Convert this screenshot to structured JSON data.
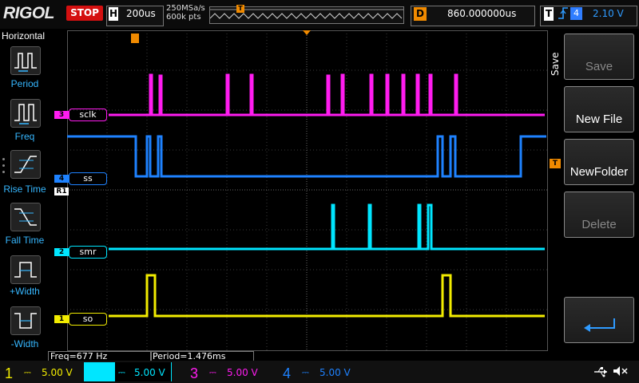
{
  "brand": "RIGOL",
  "run_state": "STOP",
  "horizontal": {
    "letter": "H",
    "timebase": "200us",
    "sample_rate": "250MSa/s",
    "memory_depth": "600k pts"
  },
  "trigger_position_marker": "T",
  "delay": {
    "letter": "D",
    "value": "860.000000us"
  },
  "trigger": {
    "letter": "T",
    "edge_icon": "rising-edge-icon",
    "source": "4",
    "level": "2.10 V"
  },
  "left_menu": {
    "title": "Horizontal",
    "items": [
      {
        "label": "Period",
        "icon": "period-measure-icon"
      },
      {
        "label": "Freq",
        "icon": "frequency-measure-icon"
      },
      {
        "label": "Rise Time",
        "icon": "rise-time-icon"
      },
      {
        "label": "Fall Time",
        "icon": "fall-time-icon"
      },
      {
        "label": "+Width",
        "icon": "positive-width-icon"
      },
      {
        "label": "-Width",
        "icon": "negative-width-icon"
      }
    ]
  },
  "right_menu": {
    "title": "Save",
    "buttons": [
      {
        "label": "Save",
        "enabled": false
      },
      {
        "label": "New File",
        "enabled": true
      },
      {
        "label": "NewFolder",
        "enabled": true
      },
      {
        "label": "Delete",
        "enabled": false
      },
      {
        "label": "",
        "icon": "return-arrow-icon",
        "enabled": true
      }
    ]
  },
  "measurements": {
    "freq": "Freq=677 Hz",
    "period": "Period=1.476ms"
  },
  "channels": [
    {
      "num": "1",
      "coupling_icon": "dc-coupling-icon",
      "scale": "5.00 V",
      "color": "#f2ec00",
      "label": "so"
    },
    {
      "num": "2",
      "coupling_icon": "dc-coupling-icon",
      "scale": "5.00 V",
      "color": "#00e6ff",
      "label": "smr"
    },
    {
      "num": "3",
      "coupling_icon": "dc-coupling-icon",
      "scale": "5.00 V",
      "color": "#ff1cf0",
      "label": "sclk"
    },
    {
      "num": "4",
      "coupling_icon": "dc-coupling-icon",
      "scale": "5.00 V",
      "color": "#1e82ff",
      "label": "ss"
    }
  ],
  "ref_marker": "R1",
  "trigger_level_marker": "T",
  "status_icons": [
    "usb-icon",
    "speaker-muted-icon"
  ],
  "colors": {
    "accent_orange": "#f08a00",
    "grid": "#3a3a3a",
    "stop_red": "#d41010"
  }
}
